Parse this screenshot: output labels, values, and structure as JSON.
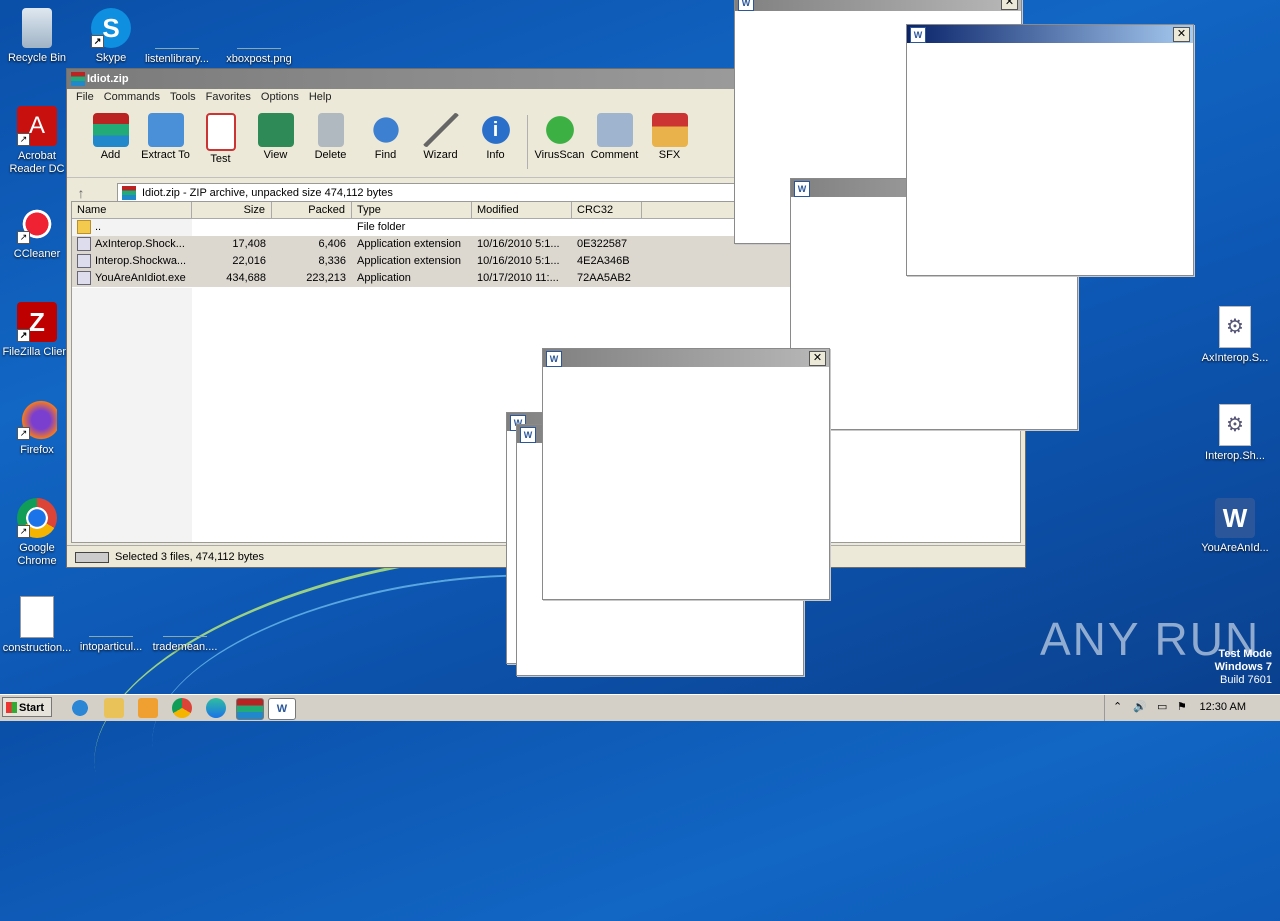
{
  "desktop_icons": [
    {
      "label": "Recycle Bin"
    },
    {
      "label": "Skype"
    },
    {
      "label": "listenlibrary..."
    },
    {
      "label": "xboxpost.png"
    },
    {
      "label": "Acrobat Reader DC"
    },
    {
      "label": "CCleaner"
    },
    {
      "label": "FileZilla Client"
    },
    {
      "label": "Firefox"
    },
    {
      "label": "Google Chrome"
    },
    {
      "label": "construction..."
    },
    {
      "label": "intoparticul..."
    },
    {
      "label": "trademean...."
    },
    {
      "label": "AxInterop.S..."
    },
    {
      "label": "Interop.Sh..."
    },
    {
      "label": "YouAreAnId..."
    }
  ],
  "rar": {
    "title": "Idiot.zip",
    "menu": [
      "File",
      "Commands",
      "Tools",
      "Favorites",
      "Options",
      "Help"
    ],
    "tools": [
      "Add",
      "Extract To",
      "Test",
      "View",
      "Delete",
      "Find",
      "Wizard",
      "Info",
      "VirusScan",
      "Comment",
      "SFX"
    ],
    "address": "Idiot.zip - ZIP archive, unpacked size 474,112 bytes",
    "columns": [
      "Name",
      "Size",
      "Packed",
      "Type",
      "Modified",
      "CRC32"
    ],
    "rows": [
      {
        "name": "..",
        "size": "",
        "packed": "",
        "type": "File folder",
        "modified": "",
        "crc": ""
      },
      {
        "name": "AxInterop.Shock...",
        "size": "17,408",
        "packed": "6,406",
        "type": "Application extension",
        "modified": "10/16/2010 5:1...",
        "crc": "0E322587"
      },
      {
        "name": "Interop.Shockwa...",
        "size": "22,016",
        "packed": "8,336",
        "type": "Application extension",
        "modified": "10/16/2010 5:1...",
        "crc": "4E2A346B"
      },
      {
        "name": "YouAreAnIdiot.exe",
        "size": "434,688",
        "packed": "223,213",
        "type": "Application",
        "modified": "10/17/2010 11:...",
        "crc": "72AA5AB2"
      }
    ],
    "status": "Selected 3 files, 474,112 bytes"
  },
  "popup_close": "✕",
  "taskbar": {
    "start": "Start",
    "clock": "12:30 AM"
  },
  "watermark": {
    "line1": "Test Mode",
    "line2": "Windows 7",
    "line3": "Build 7601"
  },
  "brand": "ANY RUN"
}
